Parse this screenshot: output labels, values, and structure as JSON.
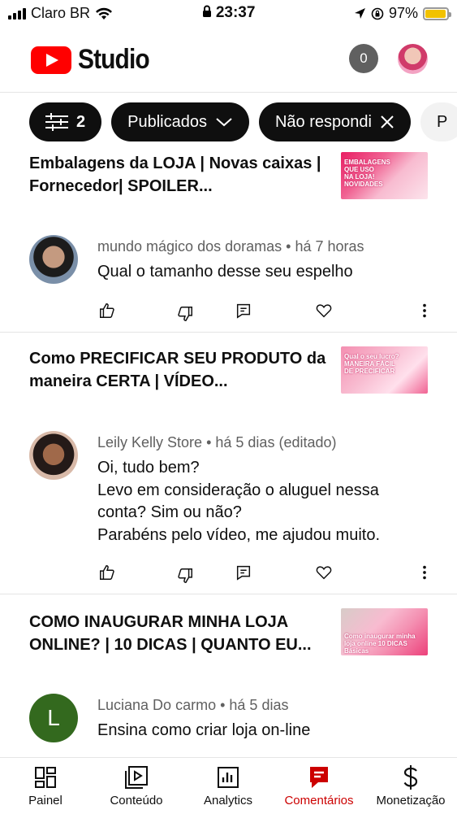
{
  "status": {
    "carrier": "Claro BR",
    "time": "23:37",
    "battery": "97%"
  },
  "header": {
    "app_name": "Studio",
    "notification_count": "0"
  },
  "filters": {
    "count": "2",
    "chips": [
      "Publicados",
      "Não respondi",
      "P"
    ]
  },
  "comments": [
    {
      "video_title": "Embalagens da LOJA | Novas caixas | Fornecedor| SPOILER...",
      "thumb_text": "EMBALAGENS QUE USO NA LOJA! NOVIDADES",
      "author": "mundo mágico dos doramas",
      "time": "há 7 horas",
      "text": "Qual o tamanho desse seu espelho"
    },
    {
      "video_title": "Como PRECIFICAR SEU PRODUTO da maneira CERTA | VÍDEO...",
      "thumb_text": "Qual o seu lucro? MANEIRA FÁCIL DE PRECIFICAR",
      "author": "Leily Kelly Store",
      "time": "há 5 dias (editado)",
      "text_lines": [
        "Oi, tudo bem?",
        "Levo em consideração  o aluguel  nessa conta?  Sim ou não?",
        "Parabéns pelo vídeo,  me ajudou muito."
      ]
    },
    {
      "video_title": "COMO INAUGURAR MINHA LOJA ONLINE? | 10 DICAS | QUANTO EU...",
      "thumb_text": "Como inaugurar minha loja online 10 DICAS Básicas",
      "author": "Luciana Do carmo",
      "author_initial": "L",
      "time": "há 5 dias",
      "text": "Ensina como criar loja on-line"
    }
  ],
  "nav": [
    {
      "label": "Painel",
      "icon": "dashboard-icon"
    },
    {
      "label": "Conteúdo",
      "icon": "content-icon"
    },
    {
      "label": "Analytics",
      "icon": "analytics-icon"
    },
    {
      "label": "Comentários",
      "icon": "comments-icon",
      "active": true
    },
    {
      "label": "Monetização",
      "icon": "dollar-icon"
    }
  ],
  "colors": {
    "brand_red": "#ff0000",
    "active_red": "#cc0000",
    "chip_dark": "#0f0f0f",
    "battery": "#f2c200"
  }
}
